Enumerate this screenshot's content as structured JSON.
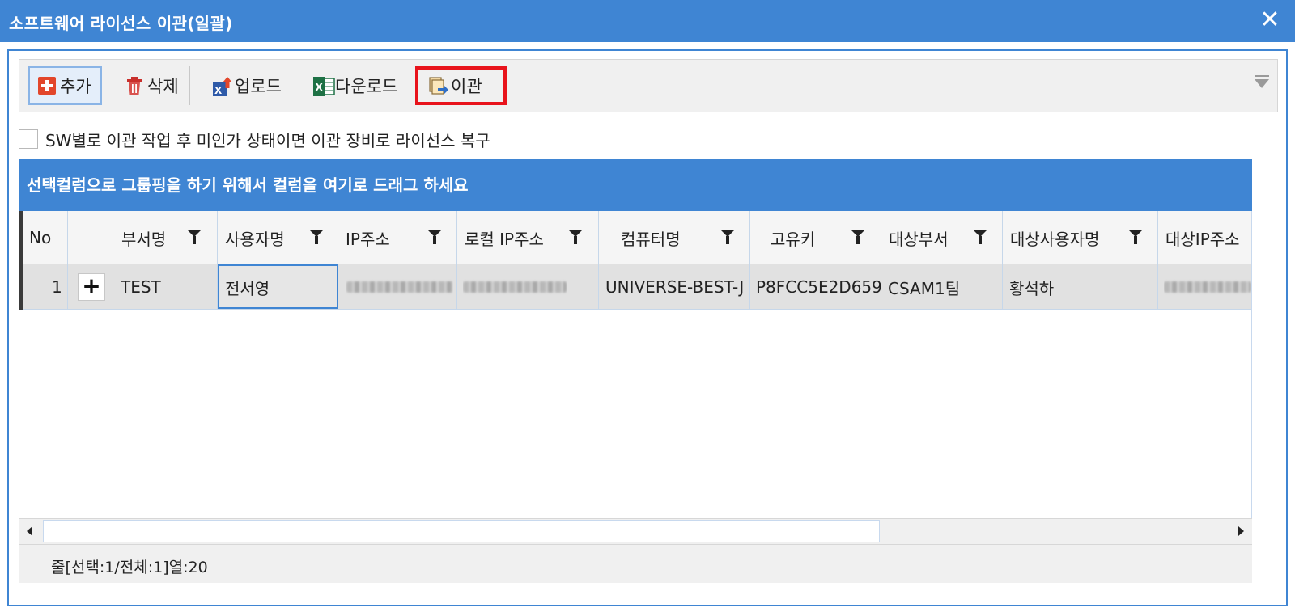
{
  "window": {
    "title": "소프트웨어 라이선스 이관(일괄)",
    "close_glyph": "✕"
  },
  "toolbar": {
    "add_label": "추가",
    "delete_label": "삭제",
    "upload_label": "업로드",
    "download_label": "다운로드",
    "transfer_label": "이관"
  },
  "option": {
    "label": "SW별로 이관 작업 후 미인가 상태이면 이관 장비로 라이선스 복구",
    "checked": false
  },
  "group_panel": {
    "text": "선택컬럼으로 그룹핑을 하기 위해서 컬럼을 여기로 드래그 하세요"
  },
  "grid": {
    "columns": [
      "No",
      "",
      "부서명",
      "사용자명",
      "IP주소",
      "로컬 IP주소",
      "컴퓨터명",
      "고유키",
      "대상부서",
      "대상사용자명",
      "대상IP주소"
    ],
    "rows": [
      {
        "no": "1",
        "expand": "+",
        "dept": "TEST",
        "user": "전서영",
        "ip": "",
        "local_ip": "",
        "computer": "UNIVERSE-BEST-J",
        "key": "P8FCC5E2D659",
        "target_dept": "CSAM1팀",
        "target_user": "황석하",
        "target_ip": ""
      }
    ]
  },
  "status": {
    "text": "줄[선택:1/전체:1]열:20"
  },
  "colors": {
    "accent": "#3f85d3",
    "highlight": "#e8131b",
    "selected_row": "#e1e1e1"
  }
}
